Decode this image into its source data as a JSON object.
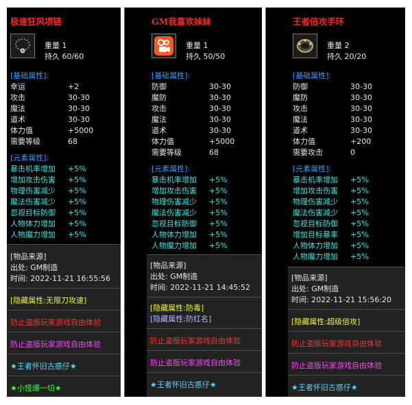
{
  "panels": [
    {
      "title": "极速狂风项链",
      "icon": "necklace-icon",
      "weight_label": "重量",
      "weight": "1",
      "durability_label": "持久",
      "durability": "60/60",
      "base_title": "[基础属性]:",
      "base_stats": [
        {
          "k": "幸运",
          "v": "+2"
        },
        {
          "k": "攻击",
          "v": "30-30"
        },
        {
          "k": "魔法",
          "v": "30-30"
        },
        {
          "k": "道术",
          "v": "30-30"
        },
        {
          "k": "体力值",
          "v": "+5000"
        },
        {
          "k": "需要等级",
          "v": "68"
        }
      ],
      "elem_title": "[元素属性]:",
      "elem_stats": [
        {
          "k": "暴击机率增加",
          "v": "+5%"
        },
        {
          "k": "增加攻击伤害",
          "v": "+5%"
        },
        {
          "k": "物理伤害减少",
          "v": "+5%"
        },
        {
          "k": "魔法伤害减少",
          "v": "+5%"
        },
        {
          "k": "忽视目标防御",
          "v": "+5%"
        },
        {
          "k": "人物体力增加",
          "v": "+5%"
        },
        {
          "k": "人物魔力增加",
          "v": "+5%"
        }
      ],
      "source_title": "[物品来源]",
      "origin_label": "出处:",
      "origin": "GM制造",
      "time_label": "时间:",
      "time": "2022-11-21 16:55:56",
      "hidden": [
        "[隐藏属性:无限刀攻速]"
      ],
      "warn1": "防止盗版玩家游戏自由体验",
      "warn2": "防止盗版玩家游戏自由体验",
      "banner": "★王者怀旧古惑仔★",
      "extra": "★小怪爆一切★"
    },
    {
      "title": "GM我喜欢妹妹",
      "icon": "kuaishou-app-icon",
      "weight_label": "重量",
      "weight": "1",
      "durability_label": "持久",
      "durability": "50/50",
      "base_title": "[基础属性]:",
      "base_stats": [
        {
          "k": "防御",
          "v": "30-30"
        },
        {
          "k": "魔防",
          "v": "30-30"
        },
        {
          "k": "攻击",
          "v": "30-30"
        },
        {
          "k": "魔法",
          "v": "30-30"
        },
        {
          "k": "道术",
          "v": "30-30"
        },
        {
          "k": "体力值",
          "v": "+5000"
        },
        {
          "k": "需要等级",
          "v": "68"
        }
      ],
      "elem_title": "[元素属性]:",
      "elem_stats": [
        {
          "k": "暴击机率增加",
          "v": "+5%"
        },
        {
          "k": "增加攻击伤害",
          "v": "+5%"
        },
        {
          "k": "物理伤害减少",
          "v": "+5%"
        },
        {
          "k": "魔法伤害减少",
          "v": "+5%"
        },
        {
          "k": "忽视目标防御",
          "v": "+5%"
        },
        {
          "k": "人物体力增加",
          "v": "+5%"
        },
        {
          "k": "人物魔力增加",
          "v": "+5%"
        }
      ],
      "source_title": "[物品来源]",
      "origin_label": "出处:",
      "origin": "GM制造",
      "time_label": "时间:",
      "time": "2022-11-21 14:45:52",
      "hidden": [
        "[隐藏属性:防毒]",
        "[隐藏属性:防红名]"
      ],
      "warn1": "防止盗版玩家游戏自由体验",
      "warn2": "防止盗版玩家游戏自由体验",
      "banner": "★王者怀旧古惑仔★",
      "extra": ""
    },
    {
      "title": "王者倍攻手环",
      "icon": "bracelet-icon",
      "weight_label": "重量",
      "weight": "2",
      "durability_label": "持久",
      "durability": "20/20",
      "base_title": "[基础属性]:",
      "base_stats": [
        {
          "k": "防御",
          "v": "30-30"
        },
        {
          "k": "魔防",
          "v": "30-30"
        },
        {
          "k": "攻击",
          "v": "30-30"
        },
        {
          "k": "魔法",
          "v": "30-30"
        },
        {
          "k": "道术",
          "v": "30-30"
        },
        {
          "k": "体力值",
          "v": "+200"
        },
        {
          "k": "需要攻击",
          "v": "0"
        }
      ],
      "elem_title": "[元素属性]:",
      "elem_stats": [
        {
          "k": "暴击机率增加",
          "v": "+5%"
        },
        {
          "k": "增加攻击伤害",
          "v": "+5%"
        },
        {
          "k": "物理伤害减少",
          "v": "+5%"
        },
        {
          "k": "魔法伤害减少",
          "v": "+5%"
        },
        {
          "k": "忽视目标防御",
          "v": "+5%"
        },
        {
          "k": "增加目标暴率",
          "v": "+5%"
        },
        {
          "k": "人物体力增加",
          "v": "+5%"
        },
        {
          "k": "人物魔力增加",
          "v": "+5%"
        }
      ],
      "source_title": "[物品来源]",
      "origin_label": "出处:",
      "origin": "GM制造",
      "time_label": "时间:",
      "time": "2022-11-21 15:56:20",
      "hidden": [
        "[隐藏属性:超级倍攻]"
      ],
      "warn1": "防止盗版玩家游戏自由体验",
      "warn2": "防止盗版玩家游戏自由体验",
      "banner": "★王者怀旧古惑仔★",
      "extra": ""
    }
  ]
}
